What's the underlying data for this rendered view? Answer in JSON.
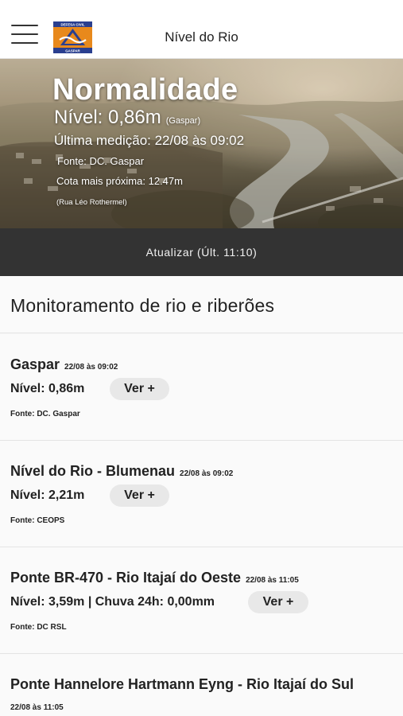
{
  "header": {
    "title": "Nível do Rio",
    "logo": {
      "top_text": "DEFESA CIVIL",
      "bottom_text": "GASPAR",
      "colors": {
        "orange": "#e8891c",
        "blue": "#2a3f8f"
      }
    }
  },
  "hero": {
    "status": "Normalidade",
    "level_label": "Nível: 0,86m",
    "level_location": "(Gaspar)",
    "last_measure": "Última medição: 22/08 às 09:02",
    "source": "Fonte: DC. Gaspar",
    "cota": "Cota mais próxima: 12.47m",
    "street": "(Rua Léo Rothermel)"
  },
  "update_button": {
    "label": "Atualizar (Últ. 11:10)"
  },
  "section": {
    "title": "Monitoramento de rio e riberões"
  },
  "stations": [
    {
      "name": "Gaspar",
      "date": "22/08 às 09:02",
      "level": "Nível: 0,86m",
      "button": "Ver +",
      "source": "Fonte: DC. Gaspar"
    },
    {
      "name": "Nível do Rio - Blumenau",
      "date": "22/08 às 09:02",
      "level": "Nível: 2,21m",
      "button": "Ver +",
      "source": "Fonte: CEOPS"
    },
    {
      "name": "Ponte BR-470 - Rio Itajaí do Oeste",
      "date": "22/08 às 11:05",
      "level": "Nível: 3,59m | Chuva 24h: 0,00mm",
      "button": "Ver +",
      "source": "Fonte: DC RSL"
    },
    {
      "name": "Ponte Hannelore Hartmann Eyng - Rio Itajaí do Sul",
      "date": "22/08 às 11:05"
    }
  ],
  "colors": {
    "update_bar": "#333333",
    "button_bg": "#e8e8e8",
    "background": "#fafafa"
  }
}
